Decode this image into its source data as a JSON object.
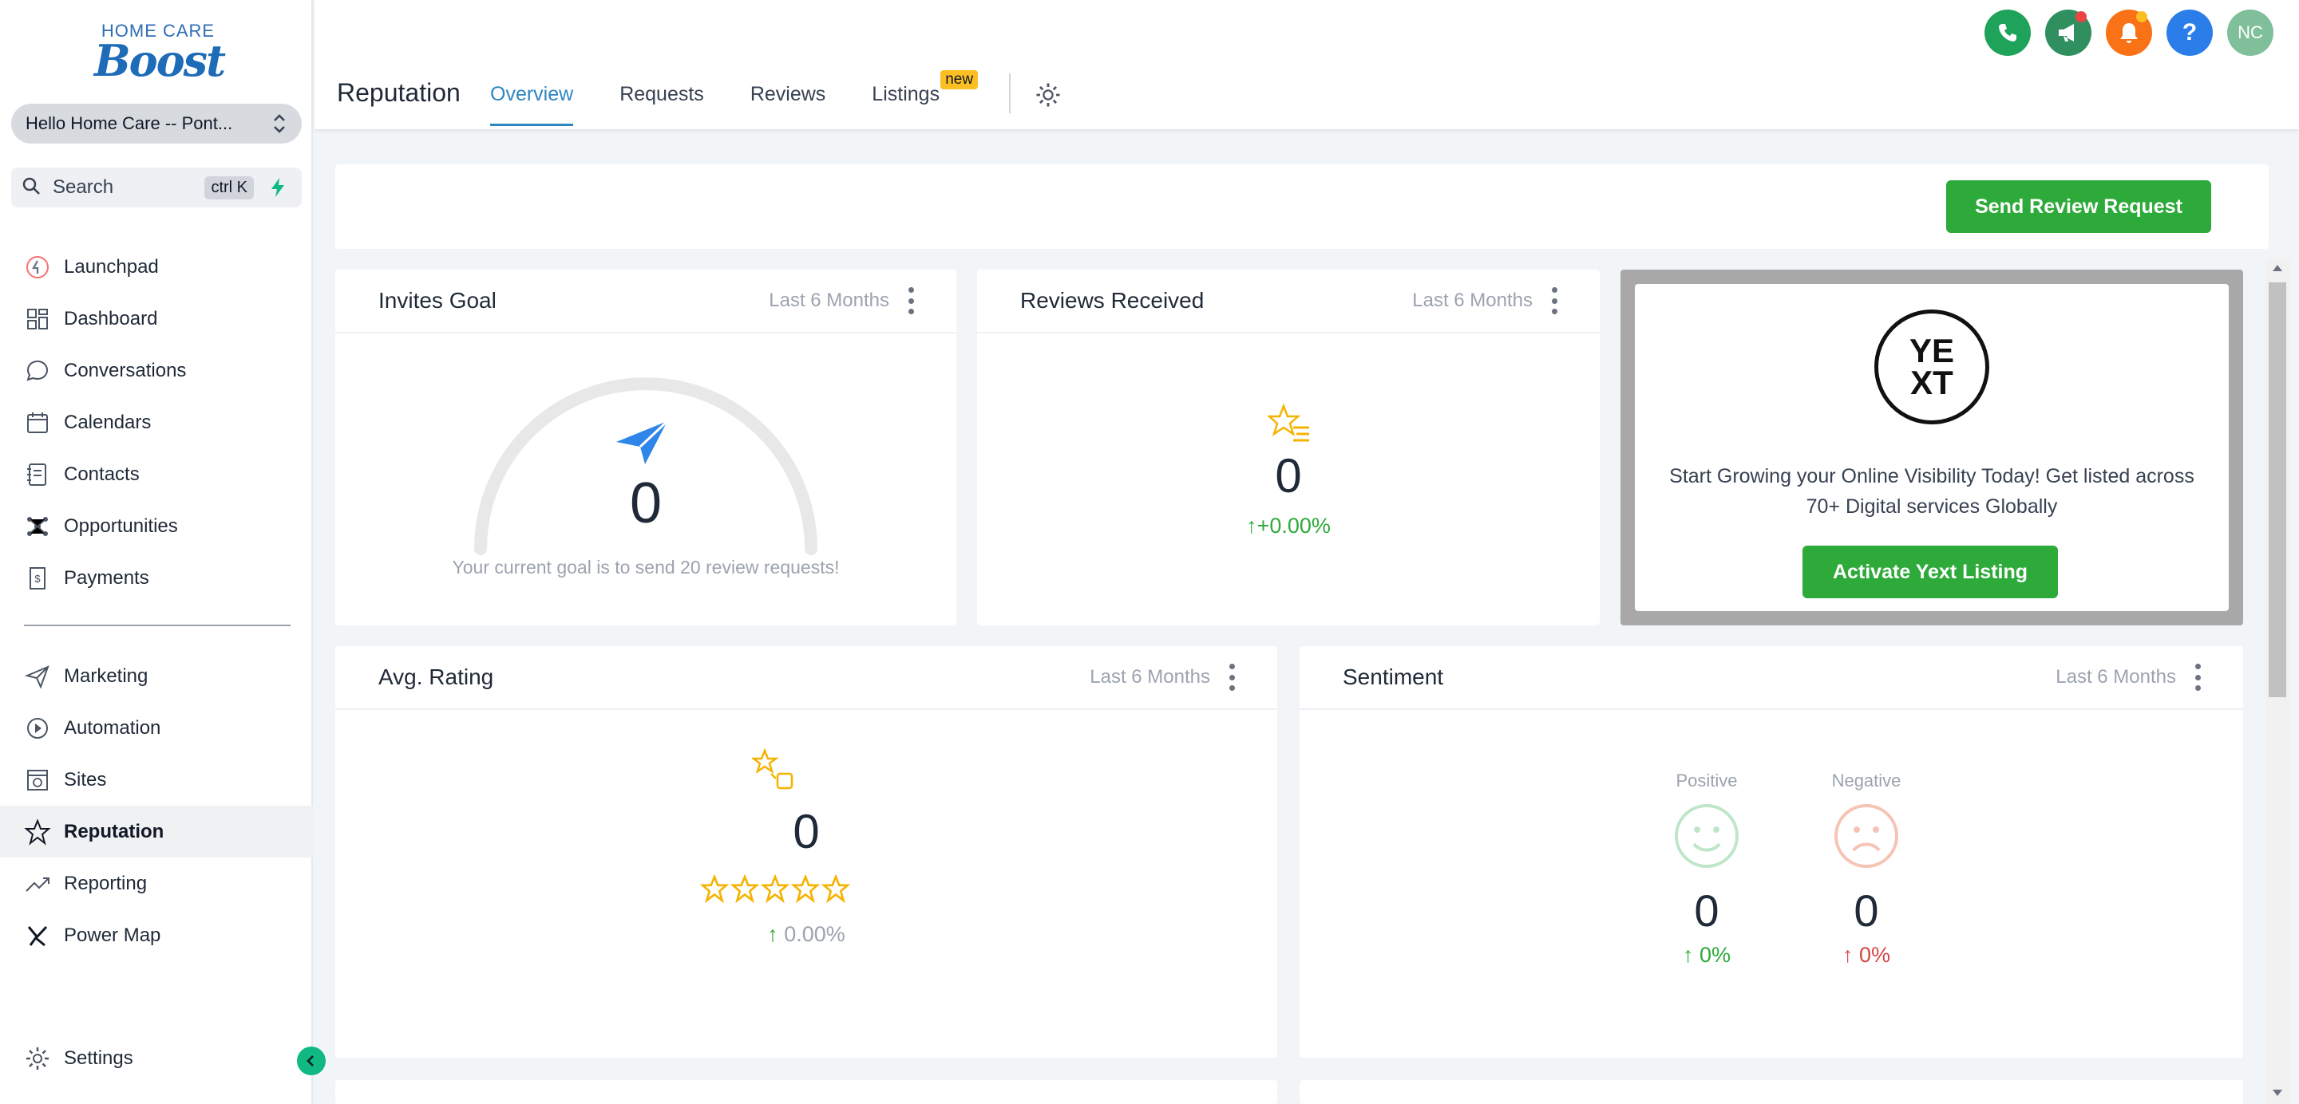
{
  "brand": {
    "line1": "HOME CARE",
    "line2": "Boost"
  },
  "account": {
    "name": "Hello Home Care -- Pont..."
  },
  "search": {
    "label": "Search",
    "shortcut": "ctrl K"
  },
  "nav": {
    "items": [
      {
        "label": "Launchpad",
        "icon": "launchpad-icon"
      },
      {
        "label": "Dashboard",
        "icon": "dashboard-icon"
      },
      {
        "label": "Conversations",
        "icon": "chat-icon"
      },
      {
        "label": "Calendars",
        "icon": "calendar-icon"
      },
      {
        "label": "Contacts",
        "icon": "contacts-icon"
      },
      {
        "label": "Opportunities",
        "icon": "opportunities-icon"
      },
      {
        "label": "Payments",
        "icon": "payments-icon"
      }
    ],
    "items2": [
      {
        "label": "Marketing",
        "icon": "send-icon"
      },
      {
        "label": "Automation",
        "icon": "automation-icon"
      },
      {
        "label": "Sites",
        "icon": "sites-icon"
      },
      {
        "label": "Reputation",
        "icon": "star-icon"
      },
      {
        "label": "Reporting",
        "icon": "trend-icon"
      },
      {
        "label": "Power Map",
        "icon": "powermap-icon"
      }
    ],
    "settings": "Settings"
  },
  "header": {
    "title": "Reputation",
    "tabs": [
      "Overview",
      "Requests",
      "Reviews",
      "Listings"
    ],
    "new_badge": "new",
    "avatar_initials": "NC"
  },
  "actions": {
    "send_review": "Send Review Request"
  },
  "invites": {
    "title": "Invites Goal",
    "period": "Last 6 Months",
    "value": "0",
    "goal_text": "Your current goal is to send 20 review requests!"
  },
  "reviews": {
    "title": "Reviews Received",
    "period": "Last 6 Months",
    "value": "0",
    "change": "+0.00%"
  },
  "yext": {
    "logo_top": "YE",
    "logo_bottom": "XT",
    "text": "Start Growing your Online Visibility Today! Get listed across 70+ Digital services Globally",
    "button": "Activate Yext Listing"
  },
  "rating": {
    "title": "Avg. Rating",
    "period": "Last 6 Months",
    "value": "0",
    "change": "0.00%"
  },
  "sentiment": {
    "title": "Sentiment",
    "period": "Last 6 Months",
    "positive_label": "Positive",
    "negative_label": "Negative",
    "positive_value": "0",
    "negative_value": "0",
    "positive_change": "0%",
    "negative_change": "0%"
  },
  "colors": {
    "accent_green": "#2eaa3a",
    "accent_blue": "#2e86c1",
    "phone": "#1fa25a",
    "megaphone": "#2f8f5f",
    "bell": "#f97316",
    "help": "#2b7de9",
    "avatar": "#7fbf9a"
  }
}
